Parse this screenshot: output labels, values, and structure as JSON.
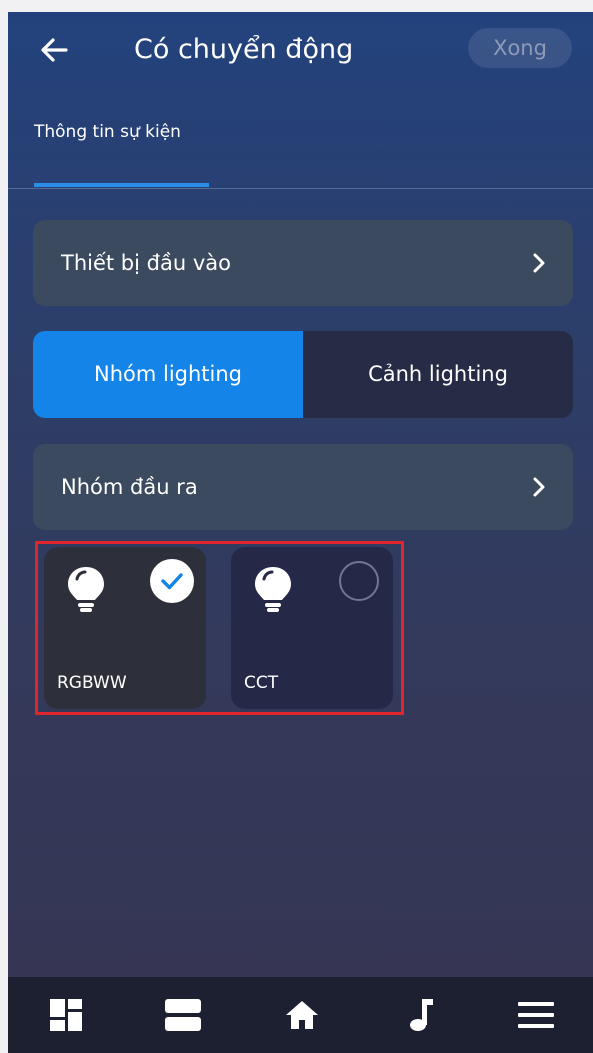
{
  "header": {
    "title": "Có chuyển động",
    "done_label": "Xong",
    "back_icon": "arrow-left-icon"
  },
  "tabs": [
    {
      "label": "Thông tin sự kiện",
      "active": true
    }
  ],
  "input_device": {
    "label": "Thiết bị đầu vào",
    "icon": "chevron-right-icon"
  },
  "segmented": {
    "options": [
      "Nhóm lighting",
      "Cảnh lighting"
    ],
    "selected": "Nhóm lighting"
  },
  "output_group": {
    "label": "Nhóm đầu ra",
    "icon": "chevron-right-icon"
  },
  "groups": [
    {
      "name": "RGBWW",
      "selected": true,
      "icon": "lightbulb-icon"
    },
    {
      "name": "CCT",
      "selected": false,
      "icon": "lightbulb-icon"
    }
  ],
  "bottom_nav": [
    {
      "icon": "dashboard-icon"
    },
    {
      "icon": "list-icon"
    },
    {
      "icon": "home-icon"
    },
    {
      "icon": "music-note-icon"
    },
    {
      "icon": "menu-icon"
    }
  ],
  "colors": {
    "accent": "#1584e8",
    "highlight": "#e0262c",
    "nav_bg": "#1d2030"
  }
}
